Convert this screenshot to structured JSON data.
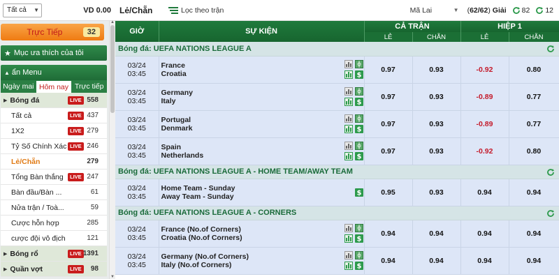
{
  "sidebar": {
    "filter_select": "Tất cả",
    "balance": "VD 0.00",
    "live_banner": {
      "label": "Trực Tiếp",
      "count": "32"
    },
    "favorites_label": "Mục ưa thích của tôi",
    "menu_label": "ẩn Menu",
    "day_tabs": [
      "Ngày mai",
      "Hôm nay",
      "Trực tiếp"
    ],
    "live_badge": "LIVE",
    "sports": [
      {
        "name": "Bóng đá",
        "count": "558"
      },
      {
        "name": "Tất cả",
        "count": "437"
      },
      {
        "name": "1X2",
        "count": "279"
      },
      {
        "name": "Tỷ Số Chính Xác",
        "count": "246"
      },
      {
        "name": "Lẻ/Chẵn",
        "count": "279"
      },
      {
        "name": "Tổng Bàn thắng",
        "count": "247"
      },
      {
        "name": "Bàn đầu/Bàn ...",
        "count": "61"
      },
      {
        "name": "Nửa trận / Toà...",
        "count": "59"
      },
      {
        "name": "Cược hỗn hợp",
        "count": "285"
      },
      {
        "name": "cược đội vô địch",
        "count": "121"
      },
      {
        "name": "Bóng rổ",
        "count": "1391"
      },
      {
        "name": "Quần vợt",
        "count": "98"
      }
    ]
  },
  "toolbar": {
    "title": "Lẻ/Chẵn",
    "filter_label": "Lọc theo trận",
    "odds_type": "Mã Lai",
    "pages_open": "(",
    "pages_value": "62/62",
    "pages_close": ")",
    "pages_suffix": " Giải",
    "refresh_a": "82",
    "refresh_b": "12"
  },
  "table": {
    "headers": {
      "time": "GIỜ",
      "event": "SỰ KIỆN",
      "full_match": "CẢ TRẬN",
      "half1": "HIỆP 1",
      "odd": "LẺ",
      "even": "CHẴN"
    },
    "leagues": [
      {
        "name": "Bóng đá: UEFA NATIONS LEAGUE A",
        "matches": [
          {
            "date": "03/24",
            "time": "03:45",
            "home": "France",
            "away": "Croatia",
            "ft_odd": "0.97",
            "ft_even": "0.93",
            "h1_odd": "-0.92",
            "h1_even": "0.80"
          },
          {
            "date": "03/24",
            "time": "03:45",
            "home": "Germany",
            "away": "Italy",
            "ft_odd": "0.97",
            "ft_even": "0.93",
            "h1_odd": "-0.89",
            "h1_even": "0.77"
          },
          {
            "date": "03/24",
            "time": "03:45",
            "home": "Portugal",
            "away": "Denmark",
            "ft_odd": "0.97",
            "ft_even": "0.93",
            "h1_odd": "-0.89",
            "h1_even": "0.77"
          },
          {
            "date": "03/24",
            "time": "03:45",
            "home": "Spain",
            "away": "Netherlands",
            "ft_odd": "0.97",
            "ft_even": "0.93",
            "h1_odd": "-0.92",
            "h1_even": "0.80"
          }
        ]
      },
      {
        "name": "Bóng đá: UEFA NATIONS LEAGUE A - HOME TEAM/AWAY TEAM",
        "matches": [
          {
            "date": "03/24",
            "time": "03:45",
            "home": "Home Team - Sunday",
            "away": "Away Team - Sunday",
            "ft_odd": "0.95",
            "ft_even": "0.93",
            "h1_odd": "0.94",
            "h1_even": "0.94"
          }
        ]
      },
      {
        "name": "Bóng đá: UEFA NATIONS LEAGUE A - CORNERS",
        "matches": [
          {
            "date": "03/24",
            "time": "03:45",
            "home": "France (No.of Corners)",
            "away": "Croatia (No.of Corners)",
            "ft_odd": "0.94",
            "ft_even": "0.94",
            "h1_odd": "0.94",
            "h1_even": "0.94"
          },
          {
            "date": "03/24",
            "time": "03:45",
            "home": "Germany (No.of Corners)",
            "away": "Italy (No.of Corners)",
            "ft_odd": "0.94",
            "ft_even": "0.94",
            "h1_odd": "0.94",
            "h1_even": "0.94"
          }
        ]
      }
    ]
  },
  "colors": {
    "header_green": "#1f7a3c",
    "league_bg": "#d5e4e6",
    "row_bg": "#dde6f7",
    "negative_odds": "#c41a2a",
    "live_orange": "#ef7b12",
    "live_badge_red": "#c91c1c"
  }
}
